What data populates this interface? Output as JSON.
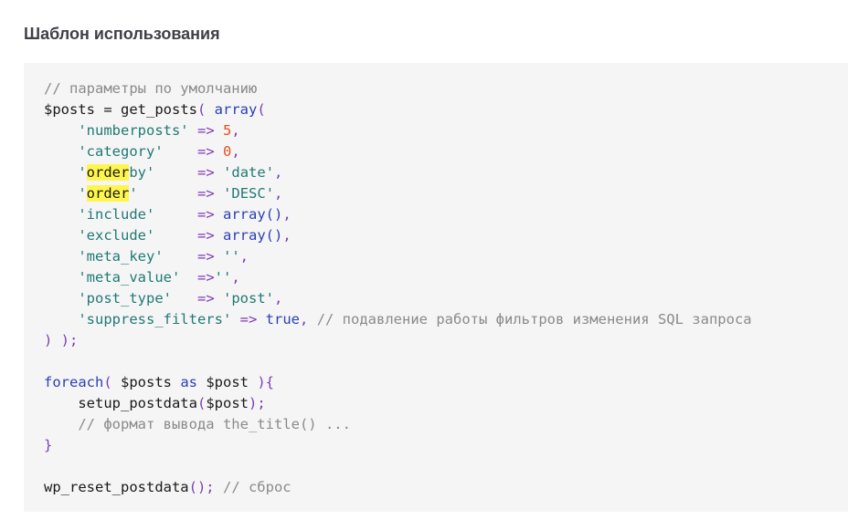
{
  "heading": "Шаблон использования",
  "code": {
    "comment_defaults": "// параметры по умолчанию",
    "var_posts": "$posts",
    "assign": " = ",
    "fn_get_posts": "get_posts",
    "paren_open": "( ",
    "kw_array": "array",
    "paren": "(",
    "indent": "    ",
    "arrow": "=>",
    "comma": ",",
    "k_numberposts": "'numberposts'",
    "v_numberposts": "5",
    "k_category": "'category'",
    "v_category": "0",
    "k_orderby_q1": "'",
    "k_orderby_hl": "order",
    "k_orderby_rest": "by'",
    "v_orderby": "'date'",
    "k_order_q1": "'",
    "k_order_hl": "order",
    "k_order_q2": "'",
    "v_order": "'DESC'",
    "k_include": "'include'",
    "v_include": "array()",
    "k_exclude": "'exclude'",
    "v_exclude": "array()",
    "k_meta_key": "'meta_key'",
    "v_meta_key": "''",
    "k_meta_value": "'meta_value'",
    "v_meta_value": "''",
    "k_post_type": "'post_type'",
    "v_post_type": "'post'",
    "k_suppress": "'suppress_filters'",
    "v_suppress": "true",
    "comment_suppress": "// подавление работы фильтров изменения SQL запроса",
    "close_array": ") );",
    "kw_foreach": "foreach",
    "foreach_open": "( ",
    "foreach_mid": "$posts",
    "kw_as": " as ",
    "var_post": "$post",
    "foreach_close": " ){",
    "fn_setup": "setup_postdata",
    "setup_open": "(",
    "setup_arg": "$post",
    "setup_close": ");",
    "comment_format": "// формат вывода the_title() ...",
    "brace_close": "}",
    "fn_reset": "wp_reset_postdata",
    "reset_parens": "();",
    "comment_reset": "// сброс"
  }
}
